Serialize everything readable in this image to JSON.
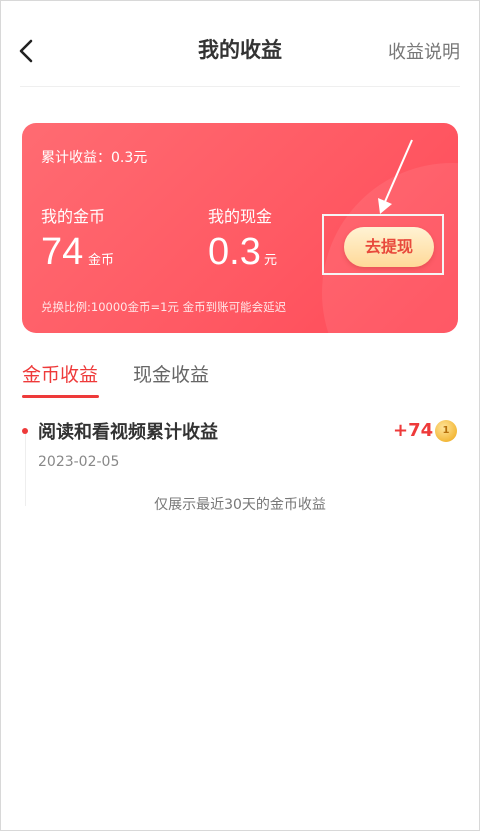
{
  "header": {
    "title": "我的收益",
    "help_label": "收益说明"
  },
  "summary_card": {
    "total_label": "累计收益：0.3元",
    "coins_label": "我的金币",
    "coins_value": "74",
    "coins_unit": "金币",
    "cash_label": "我的现金",
    "cash_value": "0.3",
    "cash_unit": "元",
    "withdraw_button": "去提现",
    "exchange_note": "兑换比例:10000金币=1元  金币到账可能会延迟"
  },
  "tabs": [
    {
      "label": "金币收益",
      "active": true
    },
    {
      "label": "现金收益",
      "active": false
    }
  ],
  "records": [
    {
      "title": "阅读和看视频累计收益",
      "date": "2023-02-05",
      "amount": "+74",
      "coin_glyph": "1"
    }
  ],
  "footer_note": "仅展示最近30天的金币收益",
  "colors": {
    "accent": "#ee3a3a",
    "card_start": "#ff6b72",
    "card_end": "#ff4a58",
    "button_bg": "#ffd998"
  },
  "icons": {
    "back": "chevron-left-icon",
    "coin": "coin-icon"
  }
}
